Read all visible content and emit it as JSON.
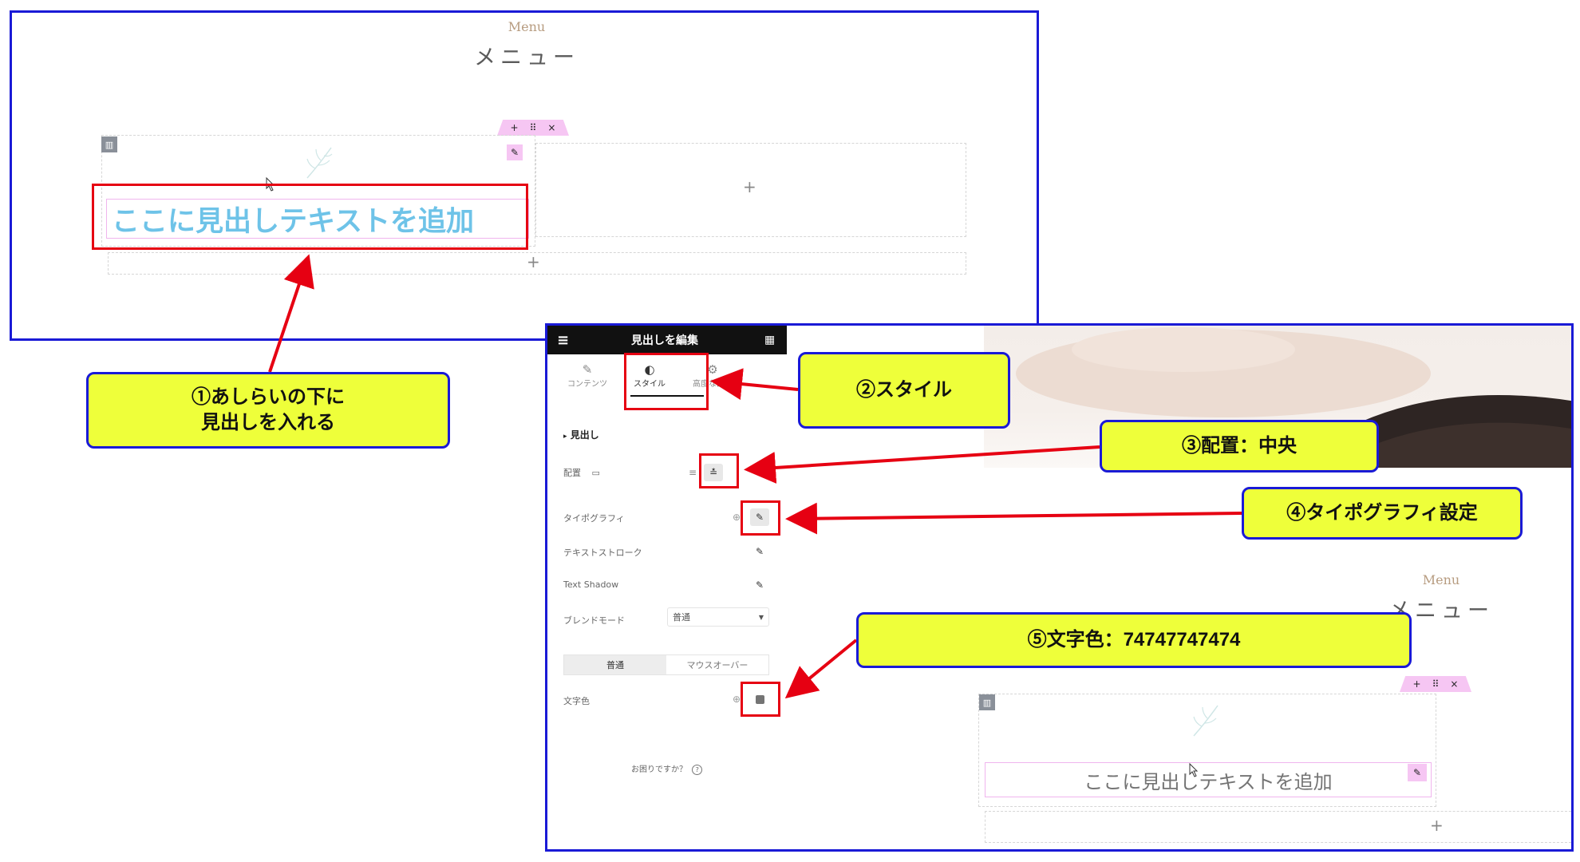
{
  "top_preview": {
    "menu_sub": "Menu",
    "menu_title": "メニュー",
    "toolbar": {
      "add": "+",
      "drag": "⠿",
      "close": "×"
    },
    "heading_placeholder": "ここに見出しテキストを追加",
    "add_plus": "+"
  },
  "panel": {
    "title": "見出しを編集",
    "tabs": [
      {
        "icon": "✎",
        "label": "コンテンツ"
      },
      {
        "icon": "◐",
        "label": "スタイル"
      },
      {
        "icon": "⚙",
        "label": "高度な設定"
      }
    ],
    "section_title": "見出し",
    "props": {
      "alignment": "配置",
      "typography": "タイポグラフィ",
      "text_stroke": "テキストストローク",
      "text_shadow": "Text Shadow",
      "blend_mode": "ブレンドモード",
      "blend_value": "普通",
      "state_normal": "普通",
      "state_hover": "マウスオーバー",
      "text_color": "文字色"
    },
    "help": "お困りですか？",
    "help_icon": "?"
  },
  "bottom_preview": {
    "menu_sub": "Menu",
    "menu_title": "メニュー",
    "heading_placeholder": "ここに見出しテキストを追加",
    "add_plus": "+"
  },
  "callouts": {
    "c1": "①あしらいの下に\n見出しを入れる",
    "c2": "②スタイル",
    "c3": "③配置：中央",
    "c4": "④タイポグラフィ設定",
    "c5": "⑤文字色：74747747474"
  },
  "colors": {
    "frame_blue": "#1a1ad6",
    "callout_fill": "#eeff3a",
    "annotation_red": "#e60012",
    "heading_blue": "#6ec3e8",
    "heading_gray": "#747474",
    "toolbar_pink": "#f6c6f3"
  }
}
